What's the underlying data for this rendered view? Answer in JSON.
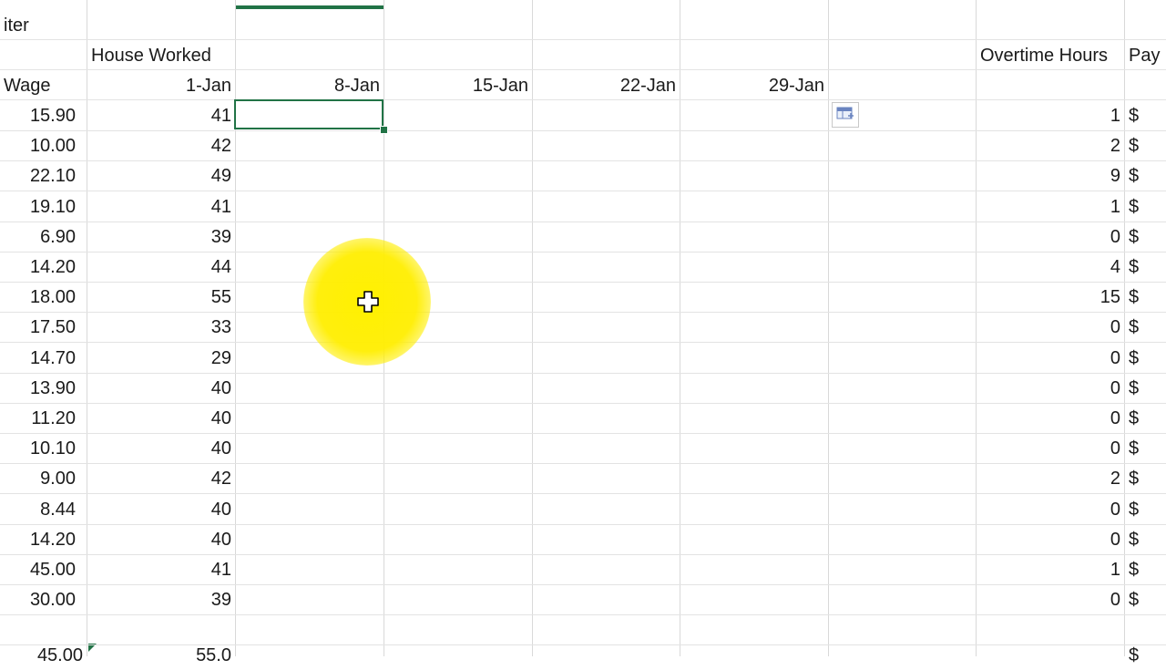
{
  "sheet": {
    "partial_title": "iter",
    "header_house_worked": "House Worked",
    "header_overtime": "Overtime Hours",
    "header_pay": "Pay",
    "header_wage": "Wage",
    "dates": [
      "1-Jan",
      "8-Jan",
      "15-Jan",
      "22-Jan",
      "29-Jan"
    ],
    "rows": [
      {
        "wage": "15.90",
        "hours": "41",
        "overtime": "1",
        "pay": "$"
      },
      {
        "wage": "10.00",
        "hours": "42",
        "overtime": "2",
        "pay": "$"
      },
      {
        "wage": "22.10",
        "hours": "49",
        "overtime": "9",
        "pay": "$"
      },
      {
        "wage": "19.10",
        "hours": "41",
        "overtime": "1",
        "pay": "$"
      },
      {
        "wage": "6.90",
        "hours": "39",
        "overtime": "0",
        "pay": "$"
      },
      {
        "wage": "14.20",
        "hours": "44",
        "overtime": "4",
        "pay": "$"
      },
      {
        "wage": "18.00",
        "hours": "55",
        "overtime": "15",
        "pay": "$"
      },
      {
        "wage": "17.50",
        "hours": "33",
        "overtime": "0",
        "pay": "$"
      },
      {
        "wage": "14.70",
        "hours": "29",
        "overtime": "0",
        "pay": "$"
      },
      {
        "wage": "13.90",
        "hours": "40",
        "overtime": "0",
        "pay": "$"
      },
      {
        "wage": "11.20",
        "hours": "40",
        "overtime": "0",
        "pay": "$"
      },
      {
        "wage": "10.10",
        "hours": "40",
        "overtime": "0",
        "pay": "$"
      },
      {
        "wage": "9.00",
        "hours": "42",
        "overtime": "2",
        "pay": "$"
      },
      {
        "wage": "8.44",
        "hours": "40",
        "overtime": "0",
        "pay": "$"
      },
      {
        "wage": "14.20",
        "hours": "40",
        "overtime": "0",
        "pay": "$"
      },
      {
        "wage": "45.00",
        "hours": "41",
        "overtime": "1",
        "pay": "$"
      },
      {
        "wage": "30.00",
        "hours": "39",
        "overtime": "0",
        "pay": "$"
      }
    ],
    "summary_partial": {
      "wage": "45.00",
      "hours": "55.0",
      "pay": "$"
    }
  },
  "icons": {
    "paste_options": "paste-options-icon",
    "cursor": "move-cursor-icon"
  },
  "colors": {
    "selection_green": "#217346",
    "cursor_highlight": "#ffee00"
  }
}
